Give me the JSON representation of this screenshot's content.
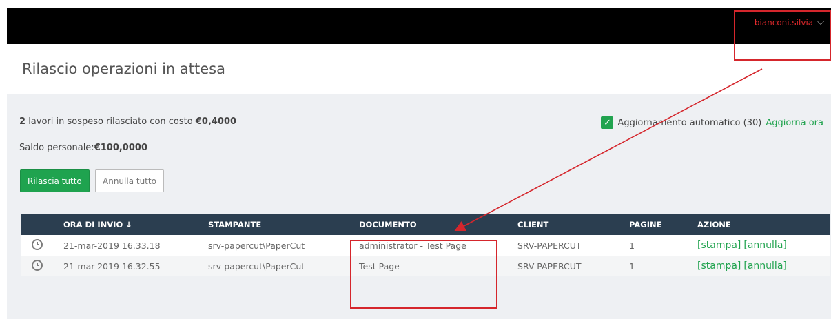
{
  "header": {
    "username": "bianconi.silvia"
  },
  "page": {
    "title": "Rilascio operazioni in attesa"
  },
  "summary": {
    "count": "2",
    "text": "lavori in sospeso rilasciato con costo",
    "cost": "€0,4000",
    "saldo_label": "Saldo personale:",
    "saldo_value": "€100,0000"
  },
  "auto_refresh": {
    "checked": true,
    "label": "Aggiornamento automatico (30)",
    "link": "Aggiorna ora"
  },
  "buttons": {
    "release_all": "Rilascia tutto",
    "cancel_all": "Annulla tutto"
  },
  "table": {
    "columns": [
      "ORA DI INVIO",
      "STAMPANTE",
      "DOCUMENTO",
      "CLIENT",
      "PAGINE",
      "AZIONE"
    ],
    "sort_indicator": "↓",
    "rows": [
      {
        "time": "21-mar-2019 16.33.18",
        "printer": "srv-papercut\\PaperCut",
        "document": "administrator - Test Page",
        "client": "SRV-PAPERCUT",
        "pages": "1",
        "print": "[stampa]",
        "cancel": "[annulla]"
      },
      {
        "time": "21-mar-2019 16.32.55",
        "printer": "srv-papercut\\PaperCut",
        "document": "Test Page",
        "client": "SRV-PAPERCUT",
        "pages": "1",
        "print": "[stampa]",
        "cancel": "[annulla]"
      }
    ]
  },
  "colors": {
    "accent_green": "#21a34f",
    "header_dark": "#2b3e50",
    "annotation_red": "#d5262c"
  },
  "icons": {
    "row_status": "clock-icon",
    "check": "checkmark-icon",
    "dropdown": "chevron-down-icon"
  }
}
